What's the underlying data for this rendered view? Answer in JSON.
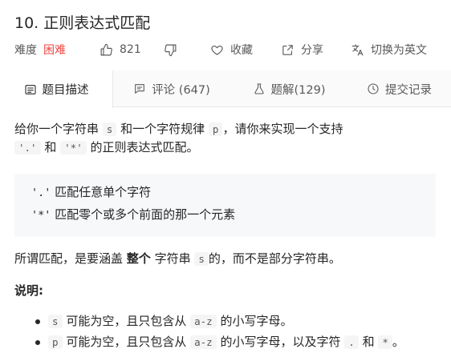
{
  "problem": {
    "title": "10. 正则表达式匹配",
    "difficulty_label": "难度",
    "difficulty_value": "困难",
    "likes": "821",
    "favorite_label": "收藏",
    "share_label": "分享",
    "switch_lang_label": "切换为英文"
  },
  "tabs": [
    {
      "label": "题目描述",
      "icon": "document-icon"
    },
    {
      "label": "评论 (647)",
      "icon": "comment-icon"
    },
    {
      "label": "题解(129)",
      "icon": "flask-icon"
    },
    {
      "label": "提交记录",
      "icon": "clock-icon"
    }
  ],
  "description": {
    "p1_a": "给你一个字符串",
    "p1_code_s": "s",
    "p1_b": "和一个字符规律",
    "p1_code_p": "p",
    "p1_c": "，请你来实现一个支持",
    "p1_code_dot": "'.'",
    "p1_d": "和",
    "p1_code_star": "'*'",
    "p1_e": "的正则表达式匹配。",
    "pre_line1_code": "'.'",
    "pre_line1_text": "匹配任意单个字符",
    "pre_line2_code": "'*'",
    "pre_line2_text": "匹配零个或多个前面的那一个元素",
    "p2_a": "所谓匹配，是要涵盖",
    "p2_bold": "整个",
    "p2_b": "字符串",
    "p2_code_s": "s",
    "p2_c": "的，而不是部分字符串。",
    "note_heading": "说明:",
    "bullet1_code": "s",
    "bullet1_a": "可能为空，且只包含从",
    "bullet1_code_range": "a-z",
    "bullet1_b": "的小写字母。",
    "bullet2_code": "p",
    "bullet2_a": "可能为空，且只包含从",
    "bullet2_code_range": "a-z",
    "bullet2_b": "的小写字母，以及字符",
    "bullet2_code_dot": ".",
    "bullet2_c": "和",
    "bullet2_code_star": "*",
    "bullet2_d": "。"
  },
  "colors": {
    "difficulty_hard": "#ef4743",
    "text": "#262626",
    "muted": "#595959",
    "code_bg": "#f5f5f5",
    "pre_bg": "#f7f8fa"
  }
}
